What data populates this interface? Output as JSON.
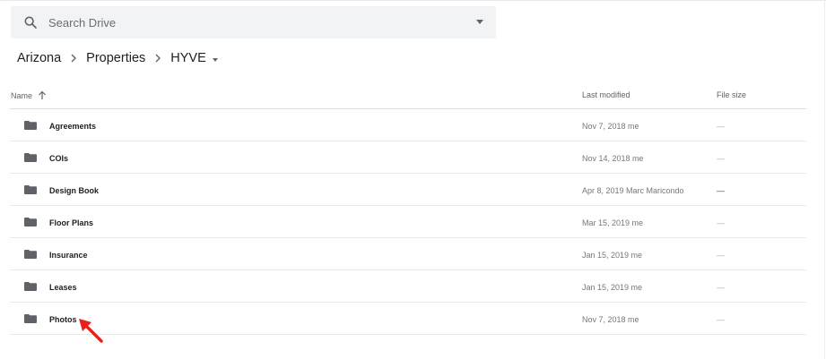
{
  "search": {
    "placeholder": "Search Drive"
  },
  "breadcrumb": {
    "items": [
      "Arizona",
      "Properties",
      "HYVE"
    ]
  },
  "table": {
    "headers": {
      "name": "Name",
      "modified": "Last modified",
      "size": "File size"
    },
    "rows": [
      {
        "name": "Agreements",
        "modified": "Nov 7, 2018 me",
        "size": "—"
      },
      {
        "name": "COIs",
        "modified": "Nov 14, 2018 me",
        "size": "—"
      },
      {
        "name": "Design Book",
        "modified": "Apr 8, 2019 Marc Maricondo",
        "size": "—"
      },
      {
        "name": "Floor Plans",
        "modified": "Mar 15, 2019 me",
        "size": "—"
      },
      {
        "name": "Insurance",
        "modified": "Jan 15, 2019 me",
        "size": "—"
      },
      {
        "name": "Leases",
        "modified": "Jan 15, 2019 me",
        "size": "—"
      },
      {
        "name": "Photos",
        "modified": "Nov 7, 2018 me",
        "size": "—"
      }
    ]
  },
  "icons": {
    "search": "search-icon",
    "folder": "folder-icon",
    "sort": "arrow-up-icon",
    "pointer": "red-arrow-pointer"
  },
  "colors": {
    "pointer": "#e8201c",
    "folder": "#5f6368"
  }
}
